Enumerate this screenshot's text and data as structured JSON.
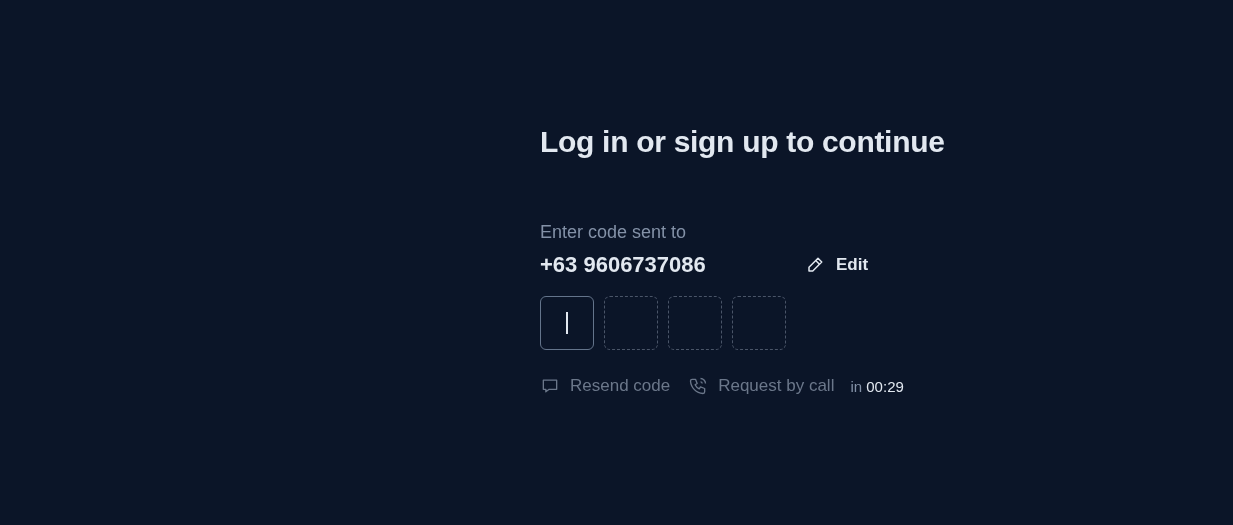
{
  "title": "Log in or sign up to continue",
  "prompt": "Enter code sent to",
  "phone": "+63 9606737086",
  "edit_button": "Edit",
  "code_boxes": [
    {
      "selected": true
    },
    {
      "selected": false
    },
    {
      "selected": false
    },
    {
      "selected": false
    }
  ],
  "actions": [
    {
      "kind": "message",
      "label": "Resend code",
      "disabled": true
    },
    {
      "kind": "call",
      "label": "Request by call",
      "disabled": true
    }
  ],
  "timer": {
    "prefix": "in",
    "time": "00:29"
  }
}
